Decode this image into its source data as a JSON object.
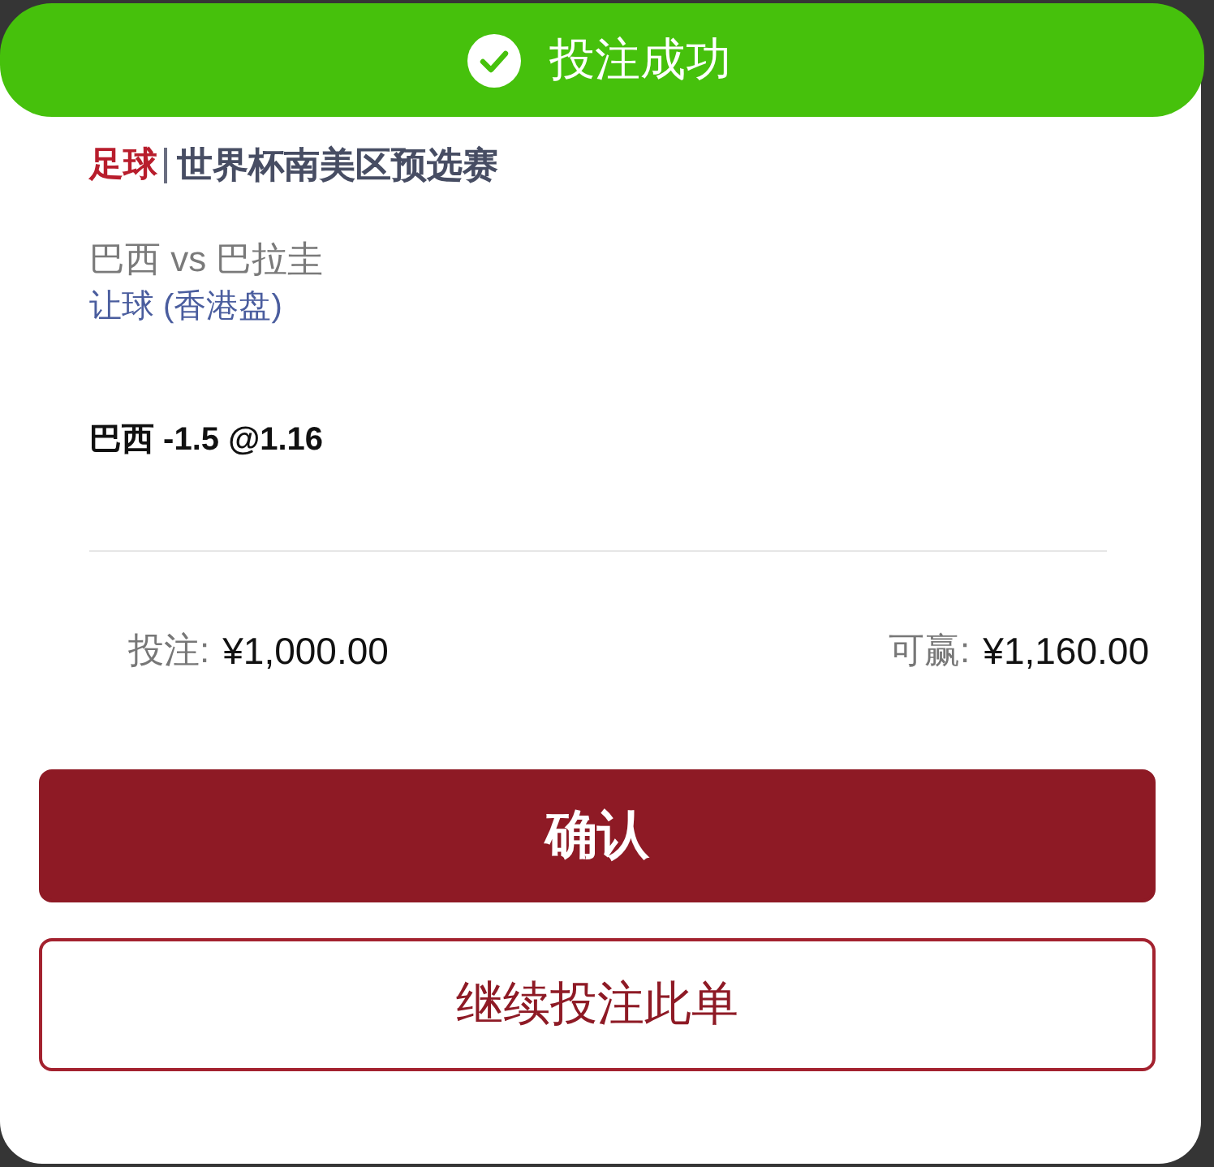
{
  "banner": {
    "kind": "success",
    "text": "投注成功"
  },
  "league": {
    "sport": "足球",
    "name": "世界杯南美区预选赛"
  },
  "match": "巴西 vs 巴拉圭",
  "market": "让球 (香港盘)",
  "selection": "巴西 -1.5 @1.16",
  "summary": [
    {
      "label": "投注:",
      "value": "¥1,000.00"
    },
    {
      "label": "可赢:",
      "value": "¥1,160.00"
    }
  ],
  "buttons": [
    {
      "label": "确认",
      "kind": "primary"
    },
    {
      "label": "继续投注此单",
      "kind": "secondary"
    }
  ]
}
